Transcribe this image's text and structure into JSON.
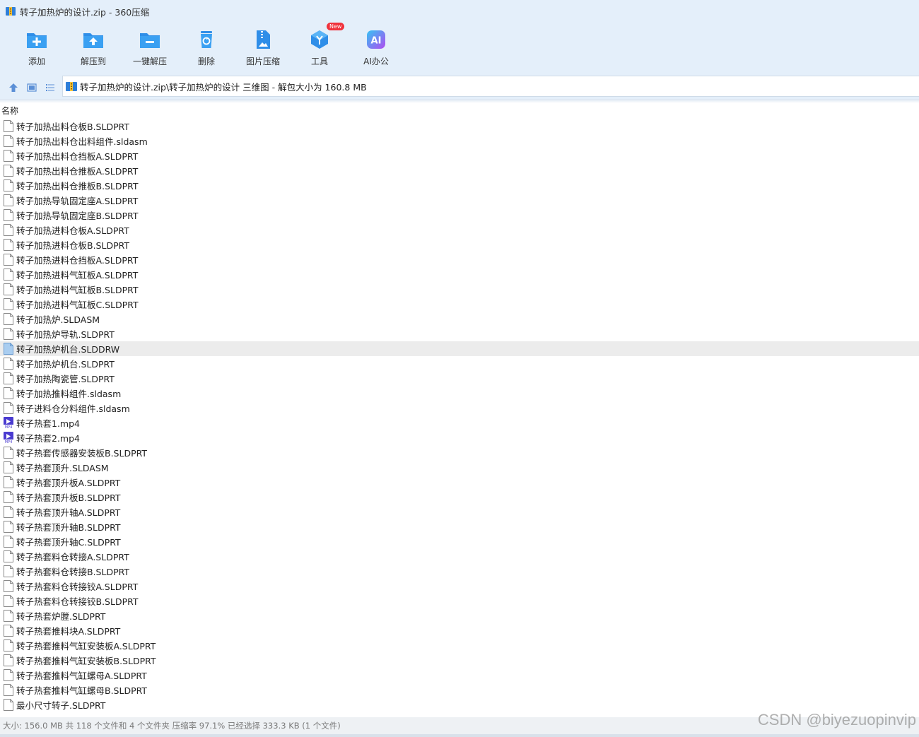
{
  "window": {
    "title": "转子加热炉的设计.zip - 360压缩"
  },
  "toolbar": {
    "items": [
      {
        "label": "添加",
        "icon": "add-folder-icon"
      },
      {
        "label": "解压到",
        "icon": "extract-to-icon"
      },
      {
        "label": "一键解压",
        "icon": "one-click-extract-icon"
      },
      {
        "label": "删除",
        "icon": "delete-icon"
      },
      {
        "label": "图片压缩",
        "icon": "image-compress-icon"
      },
      {
        "label": "工具",
        "icon": "tools-icon",
        "badge": "New"
      },
      {
        "label": "AI办公",
        "icon": "ai-office-icon"
      }
    ]
  },
  "address": {
    "path": "转子加热炉的设计.zip\\转子加热炉的设计 三维图 - 解包大小为 160.8 MB"
  },
  "list": {
    "column_name": "名称",
    "selected_index": 15,
    "files": [
      {
        "name": "转子加热出料仓板B.SLDPRT",
        "type": "doc"
      },
      {
        "name": "转子加热出料仓出料组件.sldasm",
        "type": "doc"
      },
      {
        "name": "转子加热出料仓挡板A.SLDPRT",
        "type": "doc"
      },
      {
        "name": "转子加热出料仓推板A.SLDPRT",
        "type": "doc"
      },
      {
        "name": "转子加热出料仓推板B.SLDPRT",
        "type": "doc"
      },
      {
        "name": "转子加热导轨固定座A.SLDPRT",
        "type": "doc"
      },
      {
        "name": "转子加热导轨固定座B.SLDPRT",
        "type": "doc"
      },
      {
        "name": "转子加热进料仓板A.SLDPRT",
        "type": "doc"
      },
      {
        "name": "转子加热进料仓板B.SLDPRT",
        "type": "doc"
      },
      {
        "name": "转子加热进料仓挡板A.SLDPRT",
        "type": "doc"
      },
      {
        "name": "转子加热进料气缸板A.SLDPRT",
        "type": "doc"
      },
      {
        "name": "转子加热进料气缸板B.SLDPRT",
        "type": "doc"
      },
      {
        "name": "转子加热进料气缸板C.SLDPRT",
        "type": "doc"
      },
      {
        "name": "转子加热炉.SLDASM",
        "type": "doc"
      },
      {
        "name": "转子加热炉导轨.SLDPRT",
        "type": "doc"
      },
      {
        "name": "转子加热炉机台.SLDDRW",
        "type": "drw"
      },
      {
        "name": "转子加热炉机台.SLDPRT",
        "type": "doc"
      },
      {
        "name": "转子加热陶瓷管.SLDPRT",
        "type": "doc"
      },
      {
        "name": "转子加热推料组件.sldasm",
        "type": "doc"
      },
      {
        "name": "转子进料仓分料组件.sldasm",
        "type": "doc"
      },
      {
        "name": "转子热套1.mp4",
        "type": "mp4"
      },
      {
        "name": "转子热套2.mp4",
        "type": "mp4"
      },
      {
        "name": "转子热套传感器安装板B.SLDPRT",
        "type": "doc"
      },
      {
        "name": "转子热套顶升.SLDASM",
        "type": "doc"
      },
      {
        "name": "转子热套顶升板A.SLDPRT",
        "type": "doc"
      },
      {
        "name": "转子热套顶升板B.SLDPRT",
        "type": "doc"
      },
      {
        "name": "转子热套顶升轴A.SLDPRT",
        "type": "doc"
      },
      {
        "name": "转子热套顶升轴B.SLDPRT",
        "type": "doc"
      },
      {
        "name": "转子热套顶升轴C.SLDPRT",
        "type": "doc"
      },
      {
        "name": "转子热套料仓转接A.SLDPRT",
        "type": "doc"
      },
      {
        "name": "转子热套料仓转接B.SLDPRT",
        "type": "doc"
      },
      {
        "name": "转子热套料仓转接铰A.SLDPRT",
        "type": "doc"
      },
      {
        "name": "转子热套料仓转接铰B.SLDPRT",
        "type": "doc"
      },
      {
        "name": "转子热套炉膛.SLDPRT",
        "type": "doc"
      },
      {
        "name": "转子热套推料块A.SLDPRT",
        "type": "doc"
      },
      {
        "name": "转子热套推料气缸安装板A.SLDPRT",
        "type": "doc"
      },
      {
        "name": "转子热套推料气缸安装板B.SLDPRT",
        "type": "doc"
      },
      {
        "name": "转子热套推料气缸螺母A.SLDPRT",
        "type": "doc"
      },
      {
        "name": "转子热套推料气缸螺母B.SLDPRT",
        "type": "doc"
      },
      {
        "name": "最小尺寸转子.SLDPRT",
        "type": "doc"
      }
    ]
  },
  "status": {
    "text": "大小: 156.0 MB 共 118 个文件和 4 个文件夹 压缩率 97.1% 已经选择 333.3 KB (1 个文件)"
  },
  "watermark": "CSDN @biyezuopinvip",
  "colors": {
    "toolbar_bg": "#e4effa",
    "icon_blue": "#2f8ee8",
    "badge_red": "#f0323c",
    "selected_row": "#ececec"
  }
}
